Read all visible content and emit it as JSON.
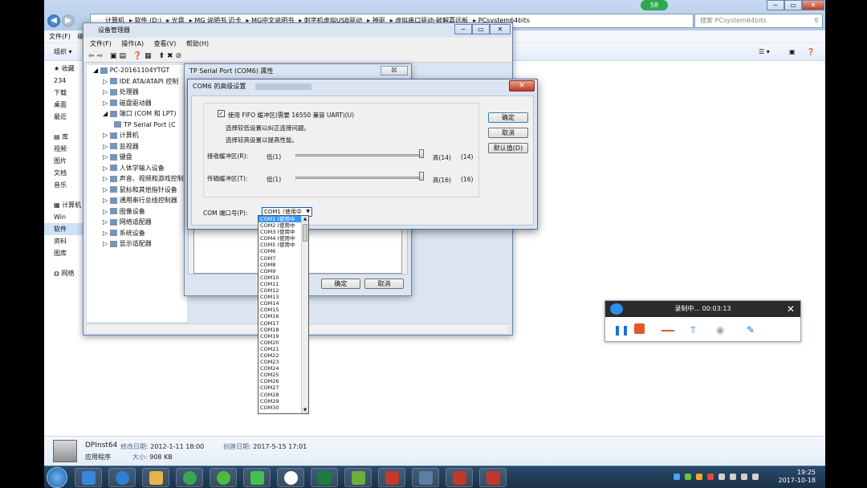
{
  "explorer": {
    "address_crumbs": [
      "计算机",
      "软件 (D:)",
      "光盘",
      "MG 说明书 迈卡",
      "MG中文说明书",
      "刺字机虚拟USB驱动",
      "神驱",
      "虚拟串口驱动-破解嘉远板",
      "PCsystem64bits"
    ],
    "search_placeholder": "搜索 PCsystem64bits",
    "menu": [
      "文件(F)",
      "编"
    ],
    "organize_label": "组织",
    "nav_items": [
      "收藏",
      "234",
      "下载",
      "桌面",
      "最近",
      "库",
      "视频",
      "图片",
      "文档",
      "音乐",
      "计算机",
      "Win",
      "软件",
      "资料",
      "图库",
      "网络"
    ]
  },
  "device_manager": {
    "title": "设备管理器",
    "menu": [
      "文件(F)",
      "操作(A)",
      "查看(V)",
      "帮助(H)"
    ],
    "tree": [
      {
        "label": "PC-20161104YTGT",
        "level": 0
      },
      {
        "label": "IDE ATA/ATAPI 控制",
        "level": 1
      },
      {
        "label": "处理器",
        "level": 1
      },
      {
        "label": "磁盘驱动器",
        "level": 1
      },
      {
        "label": "端口 (COM 和 LPT)",
        "level": 1
      },
      {
        "label": "TP Serial Port (C",
        "level": 2
      },
      {
        "label": "计算机",
        "level": 1
      },
      {
        "label": "监视器",
        "level": 1
      },
      {
        "label": "键盘",
        "level": 1
      },
      {
        "label": "人体学输入设备",
        "level": 1
      },
      {
        "label": "声音、视频和游戏控制",
        "level": 1
      },
      {
        "label": "鼠标和其他指针设备",
        "level": 1
      },
      {
        "label": "通用串行总线控制器",
        "level": 1
      },
      {
        "label": "图像设备",
        "level": 1
      },
      {
        "label": "网络适配器",
        "level": 1
      },
      {
        "label": "系统设备",
        "level": 1
      },
      {
        "label": "显示适配器",
        "level": 1
      }
    ]
  },
  "tp_props": {
    "title": "TP Serial Port (COM6) 属性",
    "close_label": "☒",
    "ok_label": "确定",
    "cancel_label": "取消"
  },
  "com6_dialog": {
    "title": "COM6 的高级设置",
    "fifo_label": "使用 FIFO 缓冲区(需要 16550 兼容 UART)(U)",
    "fifo_checked": true,
    "hint_low": "选择较低设置以纠正连接问题。",
    "hint_high": "选择较高设置以提高性能。",
    "rx_label": "接收缓冲区(R):",
    "rx_low": "低(1)",
    "rx_high": "高(14)",
    "rx_value": "(14)",
    "rx_fraction": 1.0,
    "tx_label": "传输缓冲区(T):",
    "tx_low": "低(1)",
    "tx_high": "高(16)",
    "tx_value": "(16)",
    "tx_fraction": 1.0,
    "com_label": "COM 端口号(P):",
    "com_selected": "COM1 (使用中",
    "ok_label": "确定",
    "cancel_label": "取消",
    "default_label": "默认值(D)"
  },
  "com_dropdown": {
    "items": [
      "COM1 (使用中",
      "COM2 (使用中",
      "COM3 (使用中",
      "COM4 (使用中",
      "COM5 (使用中",
      "COM6",
      "COM7",
      "COM8",
      "COM9",
      "COM10",
      "COM11",
      "COM12",
      "COM13",
      "COM14",
      "COM15",
      "COM16",
      "COM17",
      "COM18",
      "COM19",
      "COM20",
      "COM21",
      "COM22",
      "COM23",
      "COM24",
      "COM25",
      "COM26",
      "COM27",
      "COM28",
      "COM29",
      "COM30"
    ],
    "selected_index": 0
  },
  "recorder": {
    "status": "录制中... 00:03:13",
    "close_label": "✕"
  },
  "file_details": {
    "name": "DPInst64",
    "modified_label": "修改日期:",
    "modified": "2012-1-11 18:00",
    "created_label": "创建日期:",
    "created": "2017-5-15 17:01",
    "type": "应用程序",
    "size_label": "大小:",
    "size": "908 KB"
  },
  "taskbar": {
    "time": "19:25",
    "date": "2017-10-18",
    "badge": "58"
  }
}
